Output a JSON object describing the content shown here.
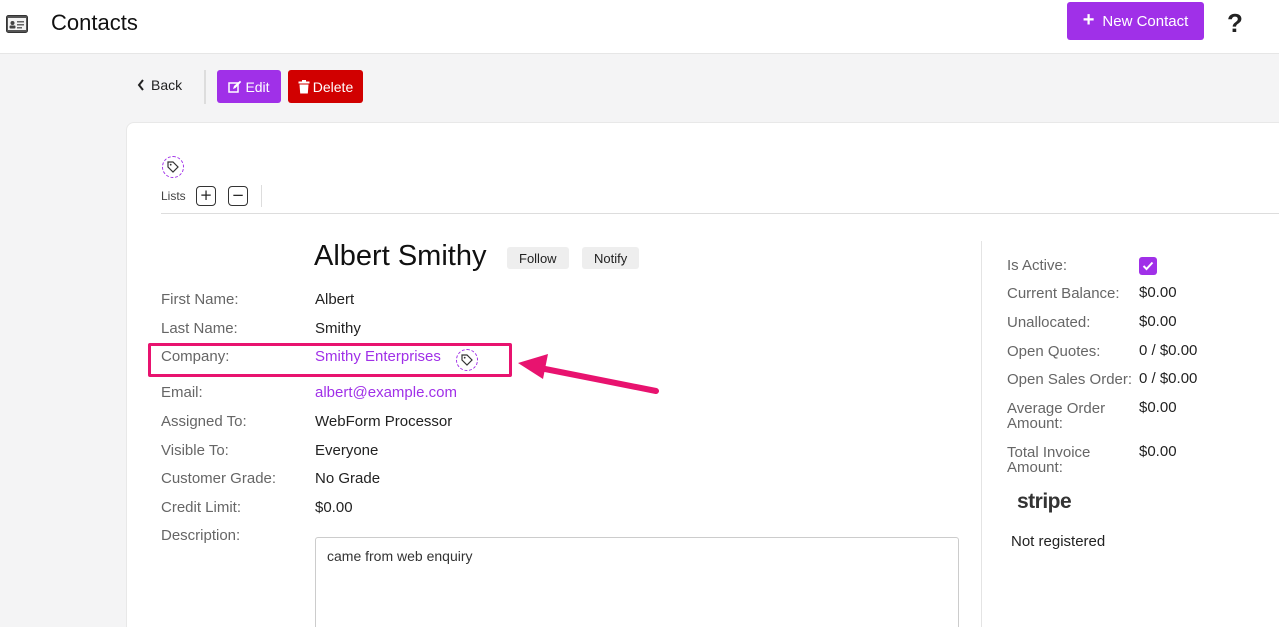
{
  "header": {
    "title": "Contacts",
    "new_contact_label": "New Contact",
    "help_label": "?"
  },
  "toolbar": {
    "back_label": "Back",
    "edit_label": "Edit",
    "delete_label": "Delete"
  },
  "lists": {
    "label": "Lists",
    "add_label": "+",
    "remove_label": "−"
  },
  "contact": {
    "name": "Albert Smithy",
    "follow_label": "Follow",
    "notify_label": "Notify",
    "fields": {
      "first_name": {
        "label": "First Name:",
        "value": "Albert"
      },
      "last_name": {
        "label": "Last Name:",
        "value": "Smithy"
      },
      "company": {
        "label": "Company:",
        "value": "Smithy Enterprises"
      },
      "email": {
        "label": "Email:",
        "value": "albert@example.com"
      },
      "assigned_to": {
        "label": "Assigned To:",
        "value": "WebForm Processor"
      },
      "visible_to": {
        "label": "Visible To:",
        "value": "Everyone"
      },
      "customer_grade": {
        "label": "Customer Grade:",
        "value": "No Grade"
      },
      "credit_limit": {
        "label": "Credit Limit:",
        "value": "$0.00"
      },
      "description": {
        "label": "Description:",
        "value": "came from web enquiry"
      }
    }
  },
  "summary": {
    "is_active": {
      "label": "Is Active:",
      "checked": true
    },
    "current_balance": {
      "label": "Current Balance:",
      "value": "$0.00"
    },
    "unallocated": {
      "label": "Unallocated:",
      "value": "$0.00"
    },
    "open_quotes": {
      "label": "Open Quotes:",
      "value": "0 / $0.00"
    },
    "open_sales_order": {
      "label": "Open Sales Order:",
      "value": "0 / $0.00"
    },
    "average_order_amount": {
      "label_line1": "Average Order",
      "label_line2": "Amount:",
      "value": "$0.00"
    },
    "total_invoice_amount": {
      "label_line1": "Total Invoice",
      "label_line2": "Amount:",
      "value": "$0.00"
    },
    "stripe": {
      "logo_text": "stripe",
      "status": "Not registered"
    }
  },
  "colors": {
    "accent": "#a030e8",
    "danger": "#d10000",
    "annotation": "#e8136f"
  },
  "icons": [
    "contact-card-icon",
    "plus-icon",
    "chevron-left-icon",
    "edit-icon",
    "trash-icon",
    "tag-icon",
    "checkmark-icon",
    "arrow-icon"
  ]
}
